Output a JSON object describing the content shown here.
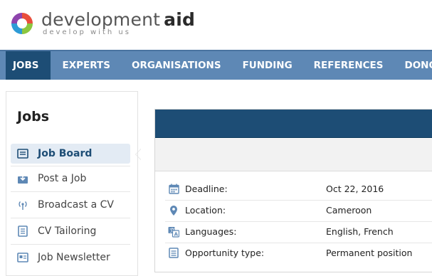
{
  "brand": {
    "name_part1": "development",
    "name_part2": "aid",
    "tagline": "develop with us",
    "colors": {
      "primary": "#5e88b5",
      "dark": "#1d4d75"
    }
  },
  "nav": {
    "items": [
      {
        "label": "JOBS",
        "active": true
      },
      {
        "label": "EXPERTS"
      },
      {
        "label": "ORGANISATIONS"
      },
      {
        "label": "FUNDING"
      },
      {
        "label": "REFERENCES"
      },
      {
        "label": "DONORS"
      }
    ]
  },
  "sidebar": {
    "title": "Jobs",
    "items": [
      {
        "label": "Job Board",
        "icon": "board-icon",
        "active": true
      },
      {
        "label": "Post a Job",
        "icon": "post-icon"
      },
      {
        "label": "Broadcast a CV",
        "icon": "broadcast-icon"
      },
      {
        "label": "CV Tailoring",
        "icon": "document-icon"
      },
      {
        "label": "Job Newsletter",
        "icon": "newsletter-icon"
      }
    ]
  },
  "details": {
    "rows": [
      {
        "label": "Deadline:",
        "value": "Oct 22, 2016",
        "icon": "calendar-icon"
      },
      {
        "label": "Location:",
        "value": "Cameroon",
        "icon": "location-pin-icon"
      },
      {
        "label": "Languages:",
        "value": "English, French",
        "icon": "language-icon"
      },
      {
        "label": "Opportunity type:",
        "value": "Permanent position",
        "icon": "list-icon"
      }
    ]
  }
}
